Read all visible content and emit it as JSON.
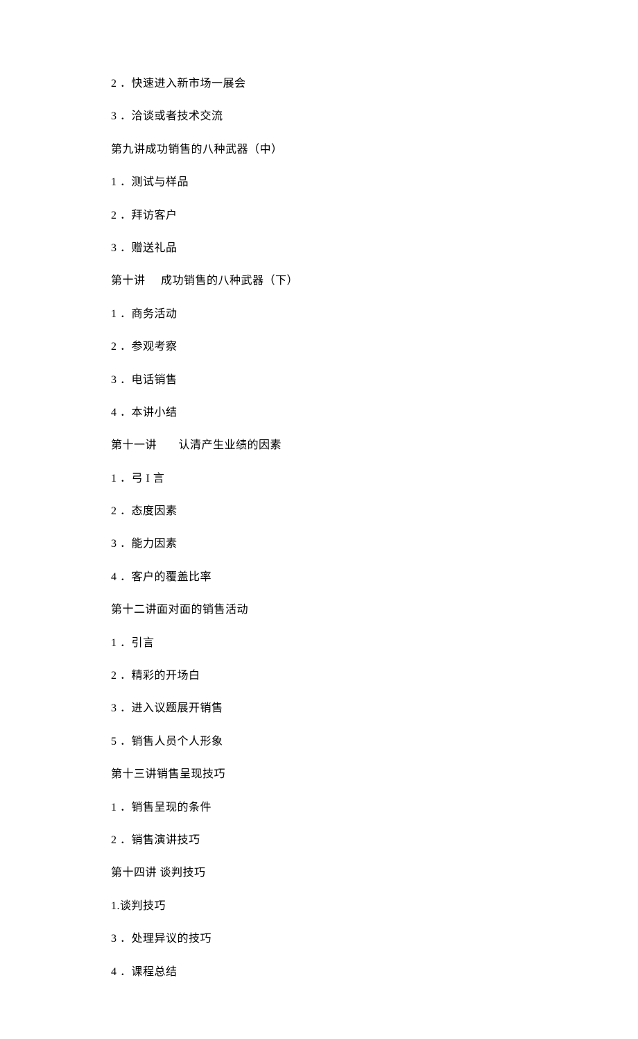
{
  "lines": [
    "2 ．快速进入新市场一展会",
    "3 ．洽谈或者技术交流",
    "第九讲成功销售的八种武器（中）",
    "1 ．测试与样品",
    "2 ．拜访客户",
    "3 ．赠送礼品",
    "第十讲     成功销售的八种武器（下）",
    "1 ．商务活动",
    "2 ．参观考察",
    "3 ．电话销售",
    "4 ．本讲小结",
    "第十一讲       认清产生业绩的因素",
    "1 ．弓 I 言",
    "2 ．态度因素",
    "3 ．能力因素",
    "4 ．客户的覆盖比率",
    "第十二讲面对面的销售活动",
    "1 ．引言",
    "2 ．精彩的开场白",
    "3 ．进入议题展开销售",
    "5 ．销售人员个人形象",
    "第十三讲销售呈现技巧",
    "1 ．销售呈现的条件",
    "2 ．销售演讲技巧",
    "第十四讲 谈判技巧",
    "1.谈判技巧",
    "3 ．处理异议的技巧",
    "4 ．课程总结"
  ]
}
